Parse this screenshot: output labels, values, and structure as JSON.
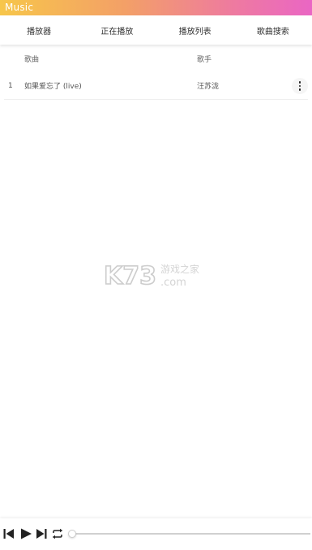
{
  "app": {
    "title": "Music"
  },
  "tabs": [
    {
      "label": "播放器"
    },
    {
      "label": "正在播放"
    },
    {
      "label": "播放列表"
    },
    {
      "label": "歌曲搜索"
    }
  ],
  "table": {
    "headers": {
      "song": "歌曲",
      "artist": "歌手"
    },
    "rows": [
      {
        "index": "1",
        "song": "如果爱忘了 (live)",
        "artist": "汪苏泷"
      }
    ]
  },
  "watermark": {
    "brand": "K73",
    "text_cn": "游戏之家",
    "text_en": ".com"
  },
  "player": {
    "progress": 0,
    "icons": [
      "skip-previous-icon",
      "play-icon",
      "skip-next-icon",
      "repeat-icon"
    ]
  },
  "colors": {
    "titlebar_gradient": [
      "#f7c64a",
      "#f3a067",
      "#ee7aa0",
      "#ea66c4"
    ],
    "text": "#333333"
  }
}
